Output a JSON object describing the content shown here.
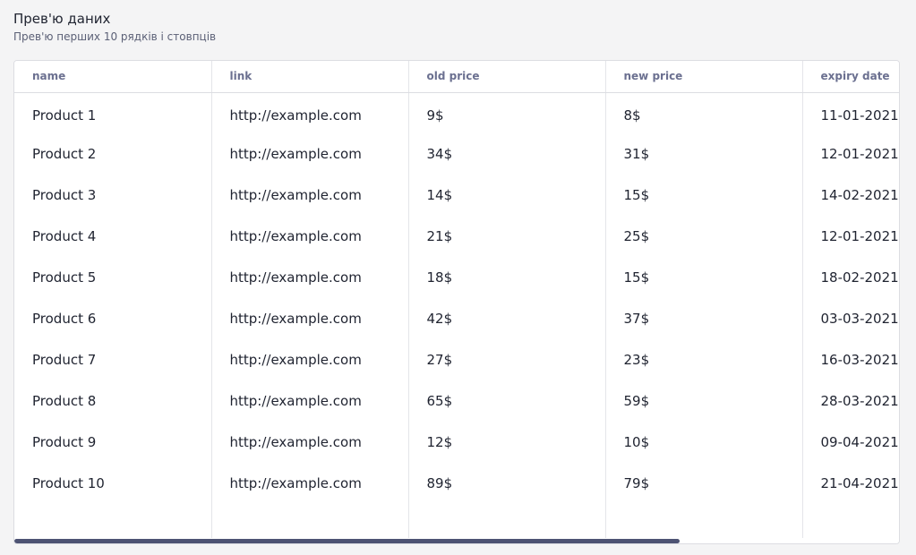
{
  "header": {
    "title": "Прев'ю даних",
    "subtitle": "Прев'ю перших 10 рядків і стовпців"
  },
  "table": {
    "columns": [
      "name",
      "link",
      "old price",
      "new price",
      "expiry date",
      ""
    ],
    "rows": [
      [
        "Product 1",
        "http://example.com",
        "9$",
        "8$",
        "11-01-2021"
      ],
      [
        "Product 2",
        "http://example.com",
        "34$",
        "31$",
        "12-01-2021"
      ],
      [
        "Product 3",
        "http://example.com",
        "14$",
        "15$",
        "14-02-2021"
      ],
      [
        "Product 4",
        "http://example.com",
        "21$",
        "25$",
        "12-01-2021"
      ],
      [
        "Product 5",
        "http://example.com",
        "18$",
        "15$",
        "18-02-2021"
      ],
      [
        "Product 6",
        "http://example.com",
        "42$",
        "37$",
        "03-03-2021"
      ],
      [
        "Product 7",
        "http://example.com",
        "27$",
        "23$",
        "16-03-2021"
      ],
      [
        "Product 8",
        "http://example.com",
        "65$",
        "59$",
        "28-03-2021"
      ],
      [
        "Product 9",
        "http://example.com",
        "12$",
        "10$",
        "09-04-2021"
      ],
      [
        "Product 10",
        "http://example.com",
        "89$",
        "79$",
        "21-04-2021"
      ]
    ]
  },
  "colors": {
    "scrollbar_thumb": "#4d5373",
    "header_text": "#6b7090",
    "body_text": "#1f2330"
  }
}
